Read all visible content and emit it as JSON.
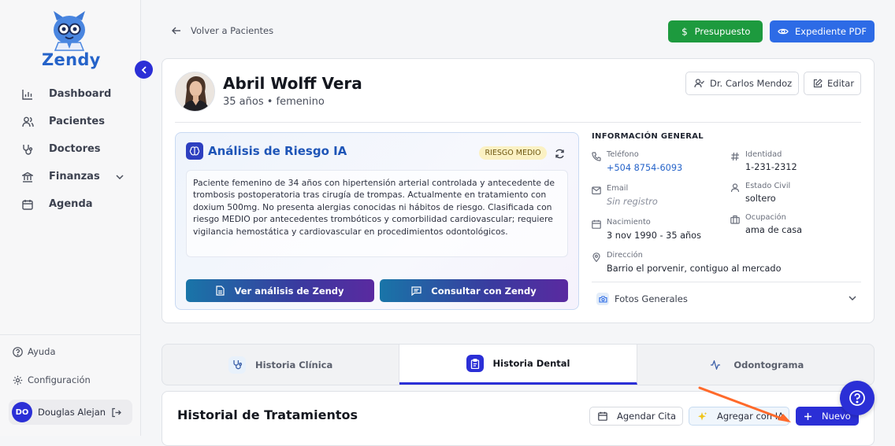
{
  "brand": {
    "name": "Zendy"
  },
  "sidebar": {
    "items": [
      {
        "label": "Dashboard",
        "icon": "bar-chart-icon"
      },
      {
        "label": "Pacientes",
        "icon": "users-icon"
      },
      {
        "label": "Doctores",
        "icon": "stethoscope-icon"
      },
      {
        "label": "Finanzas",
        "icon": "bank-icon"
      },
      {
        "label": "Agenda",
        "icon": "calendar-icon"
      }
    ],
    "help": "Ayuda",
    "settings": "Configuración",
    "user": {
      "initials": "DO",
      "name": "Douglas Alejandro"
    }
  },
  "topbar": {
    "back": "Volver a Pacientes",
    "budget_btn": "Presupuesto",
    "pdf_btn": "Expediente PDF"
  },
  "patient": {
    "name": "Abril Wolff Vera",
    "subtitle": "35 años • femenino",
    "doctor": "Dr. Carlos Mendoza",
    "edit": "Editar"
  },
  "ai": {
    "title": "Análisis de Riesgo IA",
    "badge": "RIESGO MEDIO",
    "text": "Paciente femenino de 34 años con hipertensión arterial controlada y antecedente de trombosis postoperatoria tras cirugía de trompas. Actualmente en tratamiento con doxium 500mg. No presenta alergias conocidas ni hábitos de riesgo. Clasificada con riesgo MEDIO por antecedentes trombóticos y comorbilidad cardiovascular; requiere vigilancia hemostática y cardiovascular en procedimientos odontológicos.",
    "btn_view": "Ver análisis de Zendy",
    "btn_consult": "Consultar con Zendy"
  },
  "info": {
    "title": "INFORMACIÓN GENERAL",
    "phone": {
      "label": "Teléfono",
      "value": "+504 8754-6093"
    },
    "identity": {
      "label": "Identidad",
      "value": "1-231-2312"
    },
    "email": {
      "label": "Email",
      "value": "Sin registro"
    },
    "civil": {
      "label": "Estado Civil",
      "value": "soltero"
    },
    "birth": {
      "label": "Nacimiento",
      "value": "3 nov 1990 - 35 años"
    },
    "occupation": {
      "label": "Ocupación",
      "value": "ama de casa"
    },
    "address": {
      "label": "Dirección",
      "value": "Barrio el porvenir, contiguo al mercado"
    },
    "photos": "Fotos Generales"
  },
  "tabs": [
    {
      "label": "Historia Clínica",
      "active": false
    },
    {
      "label": "Historia Dental",
      "active": true
    },
    {
      "label": "Odontograma",
      "active": false
    }
  ],
  "treatments": {
    "title": "Historial de Tratamientos",
    "btn_schedule": "Agendar Cita",
    "btn_ai": "Agregar con IA",
    "btn_new": "Nuevo"
  },
  "colors": {
    "accent": "#2b2fd6",
    "green": "#1d9a3e",
    "blue": "#2d6be6",
    "link": "#2563c9"
  }
}
